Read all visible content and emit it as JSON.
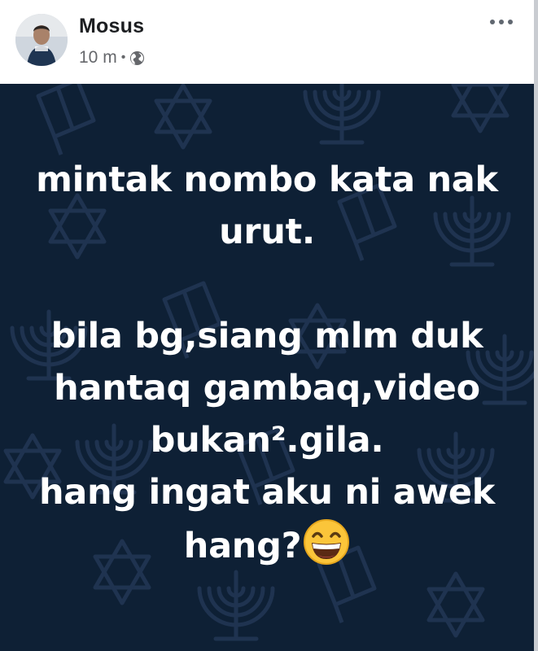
{
  "post": {
    "author": "Mosus",
    "time": "10 m",
    "separator": "•",
    "privacy_icon": "globe-icon",
    "more_icon": "more-options-icon",
    "lines": [
      "mintak nombo kata nak",
      "urut.",
      "bila bg,siang mlm duk",
      "hantaq gambaq,video",
      "bukan².gila.",
      "hang ingat aku ni awek",
      "hang?"
    ],
    "emoji": "grinning-face-emoji"
  },
  "colors": {
    "card_background": "#0e2035",
    "pattern": "#1f3350",
    "text": "#ffffff",
    "name": "#1c1e21",
    "meta": "#65676b"
  }
}
